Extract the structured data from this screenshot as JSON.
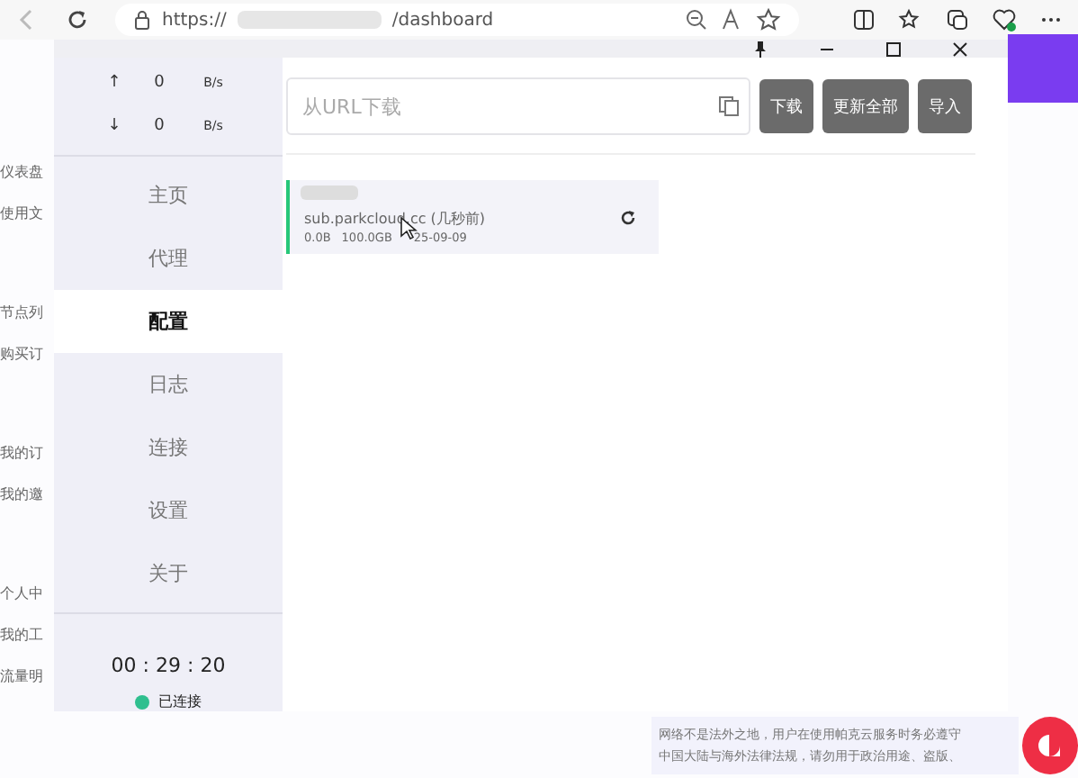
{
  "browser": {
    "url_start": "https://",
    "url_end": "/dashboard"
  },
  "background_menu": [
    "仪表盘",
    "使用文",
    "节点列",
    "购买订",
    "我的订",
    "我的邀",
    "个人中",
    "我的工",
    "流量明"
  ],
  "traffic": [
    {
      "arrow": "↑",
      "value": "0",
      "unit": "B/s"
    },
    {
      "arrow": "↓",
      "value": "0",
      "unit": "B/s"
    }
  ],
  "sidebar": {
    "items": [
      {
        "label": "主页",
        "selected": false
      },
      {
        "label": "代理",
        "selected": false
      },
      {
        "label": "配置",
        "selected": true
      },
      {
        "label": "日志",
        "selected": false
      },
      {
        "label": "连接",
        "selected": false
      },
      {
        "label": "设置",
        "selected": false
      },
      {
        "label": "关于",
        "selected": false
      }
    ],
    "timer": "00 : 29 : 20",
    "status": "已连接",
    "connected": true
  },
  "toolbar": {
    "placeholder": "从URL下载",
    "buttons": [
      "下载",
      "更新全部",
      "导入"
    ]
  },
  "profiles": [
    {
      "url": "sub.parkcloud.cc (几秒前)",
      "used": "0.0B",
      "total": "100.0GB",
      "date": "25-09-09",
      "selected": true
    }
  ],
  "footer": [
    "网络不是法外之地，用户在使用帕克云服务时务必遵守",
    "中国大陆与海外法律法规，请勿用于政治用途、盗版、"
  ]
}
